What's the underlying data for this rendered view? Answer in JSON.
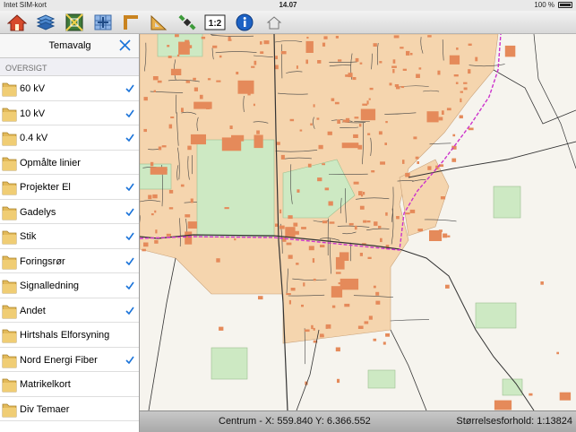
{
  "status_bar": {
    "carrier": "Intet SIM-kort",
    "time": "14.07",
    "battery": "100 %"
  },
  "toolbar": {
    "tools": [
      "home-icon",
      "layers-icon",
      "map-extent-icon",
      "grid-icon",
      "line-tool-icon",
      "triangle-tool-icon",
      "gps-icon",
      "scale-icon",
      "info-icon",
      "small-house-icon"
    ],
    "scale_icon_text": "1:2"
  },
  "panel": {
    "title": "Temavalg",
    "section": "OVERSIGT",
    "items": [
      {
        "label": "60 kV",
        "checked": true
      },
      {
        "label": "10 kV",
        "checked": true
      },
      {
        "label": "0.4 kV",
        "checked": true
      },
      {
        "label": "Opmålte linier",
        "checked": false
      },
      {
        "label": "Projekter El",
        "checked": true
      },
      {
        "label": "Gadelys",
        "checked": true
      },
      {
        "label": "Stik",
        "checked": true
      },
      {
        "label": "Foringsrør",
        "checked": true
      },
      {
        "label": "Signalledning",
        "checked": true
      },
      {
        "label": "Andet",
        "checked": true
      },
      {
        "label": "Hirtshals Elforsyning",
        "checked": false
      },
      {
        "label": "Nord Energi Fiber",
        "checked": true
      },
      {
        "label": "Matrikelkort",
        "checked": false
      },
      {
        "label": "Div Temaer",
        "checked": false
      }
    ]
  },
  "bottom_bar": {
    "centrum": "Centrum - X: 559.840  Y: 6.366.552",
    "scale": "Størrelsesforhold: 1:13824"
  },
  "colors": {
    "accent": "#1a73d9",
    "building": "#e58a5a",
    "urban": "#f5d5ae",
    "green": "#cde9c3",
    "cable": "#cc33cc"
  }
}
